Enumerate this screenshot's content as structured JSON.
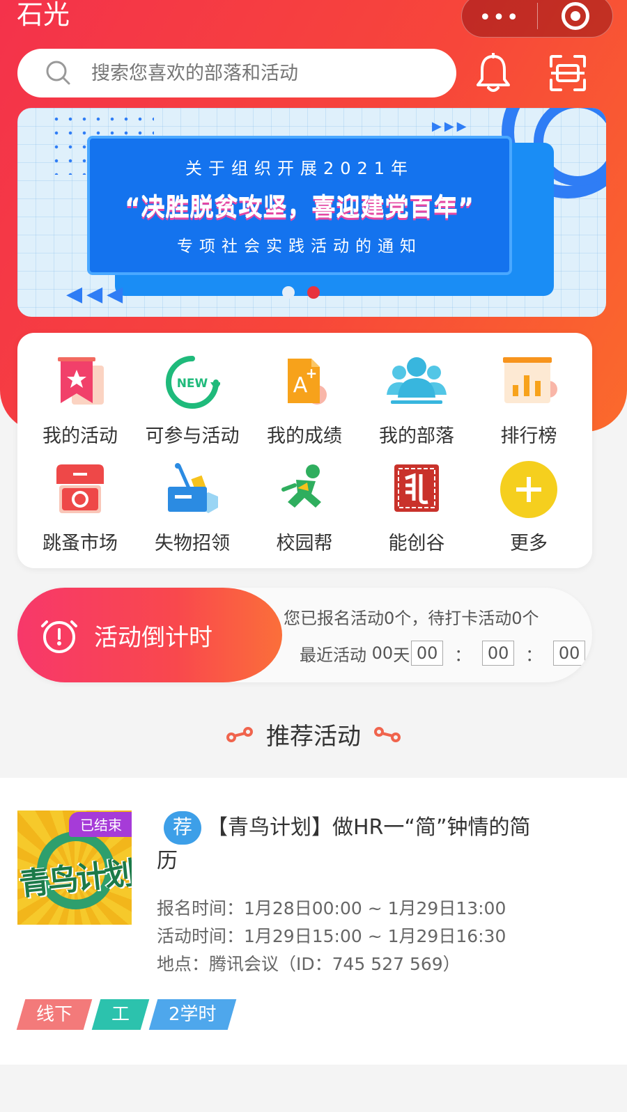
{
  "header": {
    "app_title": "石光",
    "capsule_more": "•••",
    "search_placeholder": "搜索您喜欢的部落和活动"
  },
  "banner": {
    "line1": "关于组织开展2021年",
    "line2": "“决胜脱贫攻坚，喜迎建党百年”",
    "line3": "专项社会实践活动的通知",
    "page_count": 2,
    "active_page": 2
  },
  "menu": {
    "items": [
      {
        "label": "我的活动",
        "icon": "bookmark-star-icon"
      },
      {
        "label": "可参与活动",
        "icon": "new-refresh-icon"
      },
      {
        "label": "我的成绩",
        "icon": "grade-a-plus-icon"
      },
      {
        "label": "我的部落",
        "icon": "group-people-icon"
      },
      {
        "label": "排行榜",
        "icon": "bar-chart-icon"
      },
      {
        "label": "跳蚤市场",
        "icon": "market-stall-icon"
      },
      {
        "label": "失物招领",
        "icon": "lost-box-icon"
      },
      {
        "label": "校园帮",
        "icon": "runner-icon"
      },
      {
        "label": "能创谷",
        "icon": "seal-icon"
      },
      {
        "label": "更多",
        "icon": "plus-icon"
      }
    ]
  },
  "countdown": {
    "label": "活动倒计时",
    "info": "您已报名活动0个，待打卡活动0个",
    "recent_prefix": "最近活动",
    "days": "00",
    "days_unit": "天",
    "hours": "00",
    "minutes": "00",
    "seconds": "00",
    "colon": "："
  },
  "section": {
    "title": "推荐活动"
  },
  "activity": {
    "thumb_badge": "已结束",
    "thumb_title": "青鸟计划",
    "rec_tag": "荐",
    "title": "【青鸟计划】做HR一“简”钟情的简历",
    "signup_time": "报名时间：1月28日00:00 ~ 1月29日13:00",
    "event_time": "活动时间：1月29日15:00 ~ 1月29日16:30",
    "location": "地点：腾讯会议（ID：745 527 569）",
    "tags": [
      "线下",
      "工",
      "2学时"
    ]
  },
  "colors": {
    "brand_red": "#f4324b",
    "brand_orange": "#fb6a2c",
    "banner_blue": "#1473ee",
    "tag_red": "#f37a7a",
    "tag_teal": "#2cc2ad",
    "tag_blue": "#4ea7ec"
  }
}
